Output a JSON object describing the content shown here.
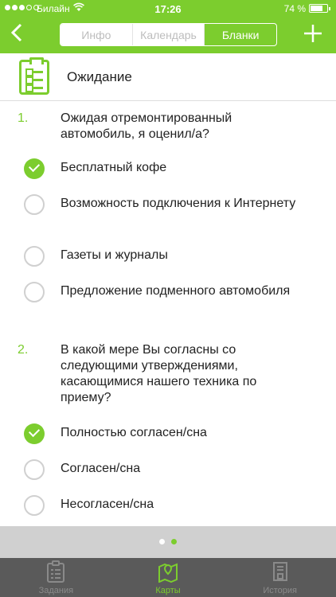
{
  "status": {
    "carrier": "Билайн",
    "time": "17:26",
    "battery": "74 %",
    "battery_level": 0.74
  },
  "nav": {
    "back_icon": "chevron-left-icon",
    "segments": [
      {
        "label": "Инфо",
        "active": false
      },
      {
        "label": "Календарь",
        "active": false
      },
      {
        "label": "Бланки",
        "active": true
      }
    ],
    "add_icon": "plus-icon"
  },
  "header": {
    "icon": "form-checklist-icon",
    "title": "Ожидание"
  },
  "questions": [
    {
      "number": "1.",
      "text": "Ожидая отремонтированный автомобиль, я оценил/а?",
      "options": [
        {
          "label": "Бесплатный кофе",
          "checked": true
        },
        {
          "label": "Возможность подключения к Интернету",
          "checked": false
        },
        {
          "label": "Газеты и журналы",
          "checked": false
        },
        {
          "label": "Предложение подменного автомобиля",
          "checked": false
        }
      ]
    },
    {
      "number": "2.",
      "text": "В какой мере Вы согласны со следующими утверждениями, касающимися нашего техника по приему?",
      "options": [
        {
          "label": "Полностью согласен/сна",
          "checked": true
        },
        {
          "label": "Согласен/сна",
          "checked": false
        },
        {
          "label": "Несогласен/сна",
          "checked": false
        }
      ]
    }
  ],
  "pager": {
    "pages": 2,
    "current": 2
  },
  "tabs": [
    {
      "label": "Задания",
      "icon": "clipboard-icon",
      "active": false
    },
    {
      "label": "Карты",
      "icon": "map-icon",
      "active": true
    },
    {
      "label": "История",
      "icon": "archive-icon",
      "active": false
    }
  ],
  "colors": {
    "accent": "#7ccd2e",
    "tabbar": "#5a5a5a",
    "pager": "#d0d0d0"
  }
}
